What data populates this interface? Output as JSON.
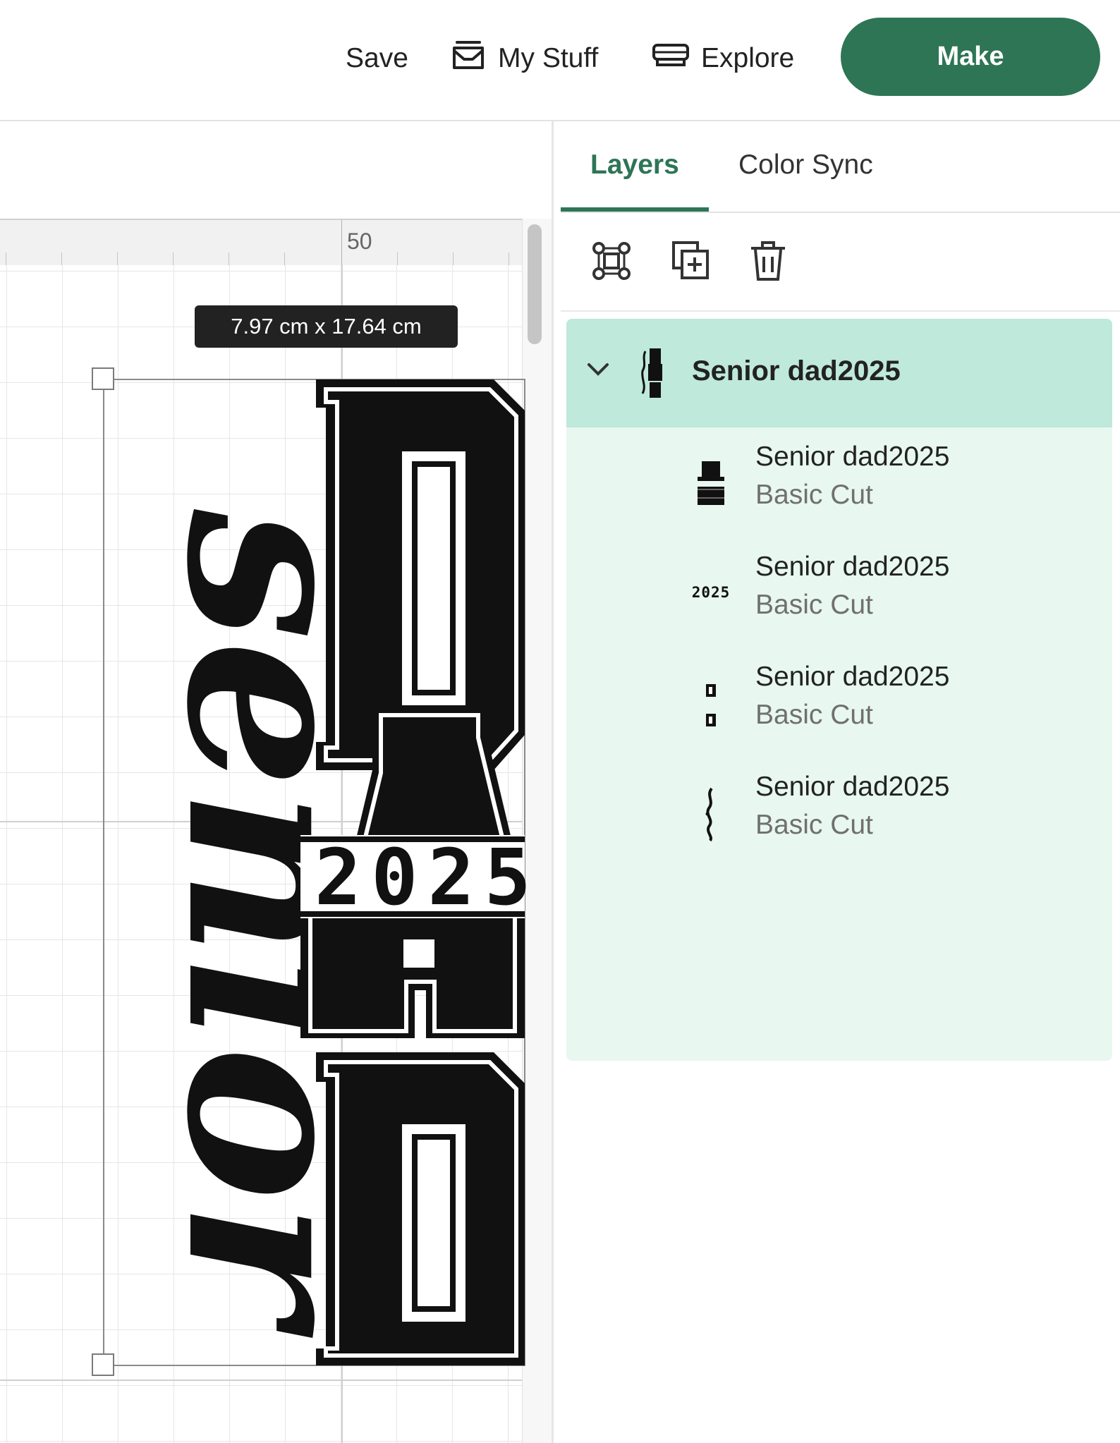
{
  "topbar": {
    "save_label": "Save",
    "my_stuff_label": "My Stuff",
    "explore_label": "Explore",
    "make_label": "Make",
    "make_color": "#2e7555"
  },
  "canvas": {
    "ruler_label": "50",
    "dimensions": "7.97  cm x 17.64  cm",
    "design_text": {
      "script_word": "senior",
      "block_letters": [
        "D",
        "A",
        "D"
      ],
      "year": "2025"
    }
  },
  "panel": {
    "tabs": [
      {
        "label": "Layers",
        "active": true
      },
      {
        "label": "Color Sync",
        "active": false
      }
    ],
    "tools": [
      {
        "icon": "group-icon"
      },
      {
        "icon": "duplicate-icon"
      },
      {
        "icon": "delete-icon"
      }
    ],
    "group": {
      "title": "Senior dad2025",
      "expanded": true,
      "layers": [
        {
          "name": "Senior dad2025",
          "operation": "Basic Cut",
          "thumb_text": "",
          "icon": "stacked-shape-thumbnail"
        },
        {
          "name": "Senior dad2025",
          "operation": "Basic Cut",
          "thumb_text": "2025",
          "icon": "year-thumbnail"
        },
        {
          "name": "Senior dad2025",
          "operation": "Basic Cut",
          "thumb_text": "",
          "icon": "d-letters-thumbnail"
        },
        {
          "name": "Senior dad2025",
          "operation": "Basic Cut",
          "thumb_text": "",
          "icon": "script-senior-thumbnail"
        }
      ]
    },
    "accent_color": "#2e7555",
    "group_header_color": "#bfe9da",
    "group_bg_color": "#e8f7f0"
  }
}
